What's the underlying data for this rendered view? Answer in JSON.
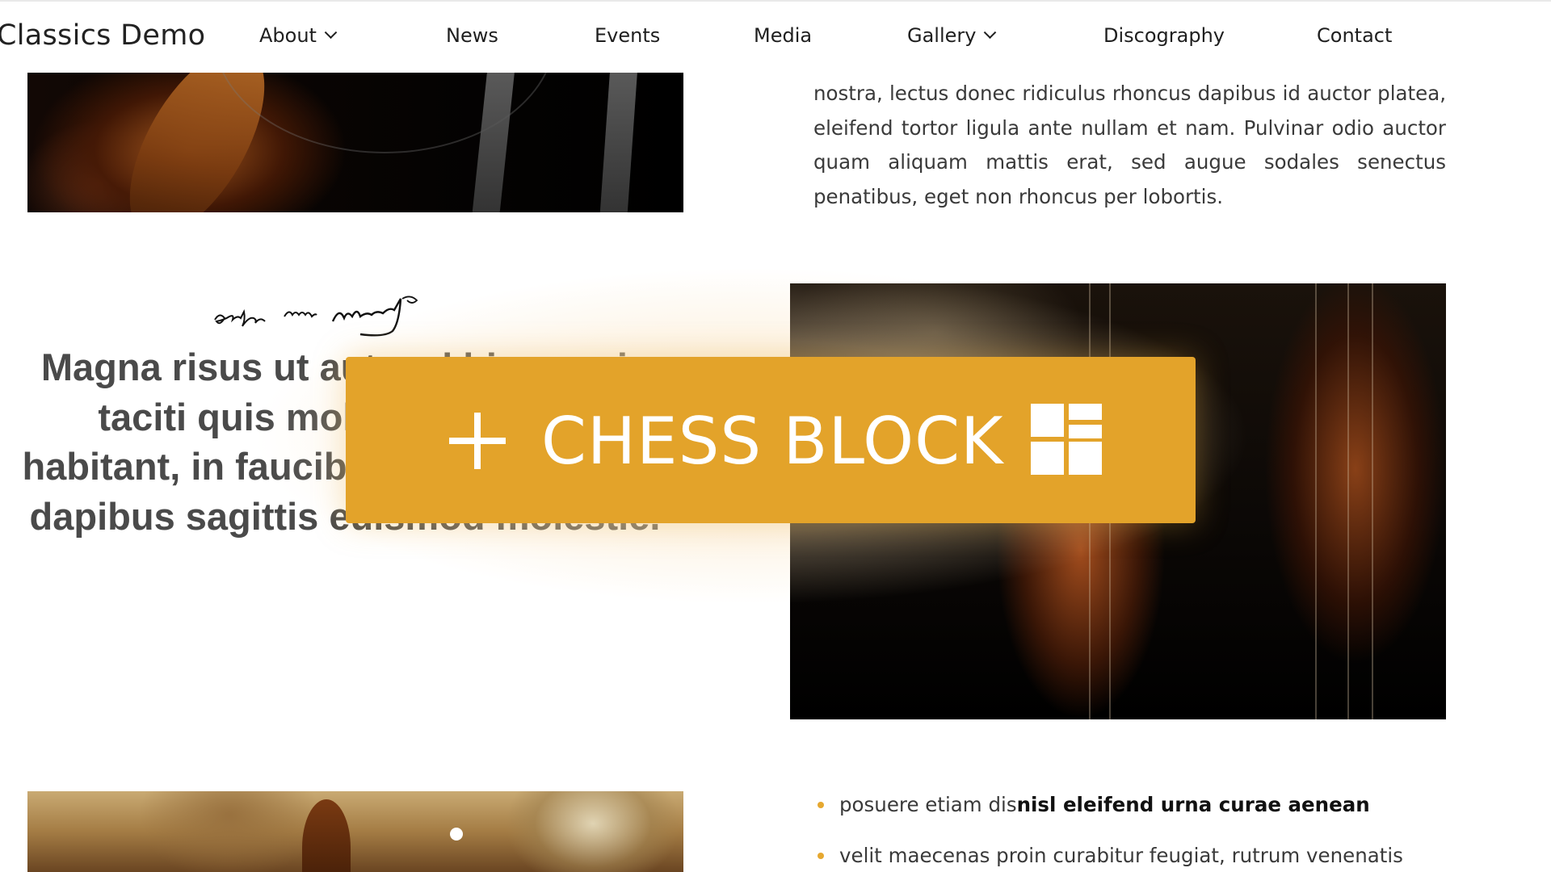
{
  "navbar": {
    "brand": "Classics Demo",
    "items": [
      {
        "label": "About",
        "has_dropdown": true
      },
      {
        "label": "News",
        "has_dropdown": false
      },
      {
        "label": "Events",
        "has_dropdown": false
      },
      {
        "label": "Media",
        "has_dropdown": false
      },
      {
        "label": "Gallery",
        "has_dropdown": true
      },
      {
        "label": "Discography",
        "has_dropdown": false
      },
      {
        "label": "Contact",
        "has_dropdown": false
      }
    ]
  },
  "content": {
    "intro_paragraph": "nostra, lectus donec ridiculus rhoncus dapibus id auctor platea, eleifend tortor ligula ante nullam et nam. Pulvinar odio auctor quam aliquam mattis erat, sed augue sodales senectus penatibus, eget non rhoncus per lobortis.",
    "signature": "Gottfgang Amadè Mozart",
    "quote": "Magna risus ut aut sed himenaeis taciti quis mollis accumsan habitant, in faucibus inceptos fusce dapibus sagittis euismod molestie.",
    "bullets": [
      {
        "text": "posuere etiam dis ",
        "bold": "nisl eleifend urna curae aenean"
      },
      {
        "text": "velit maecenas proin curabitur feugiat, rutrum venenatis",
        "bold": ""
      }
    ]
  },
  "overlay": {
    "label": "CHESS BLOCK",
    "plus_icon": "plus-icon",
    "grid_icon": "layout-grid-icon",
    "color": "#e3a32a"
  },
  "colors": {
    "accent": "#e3a32a",
    "bullet": "#e6a830",
    "text": "#3a3a3a",
    "quote": "#4a4a4a"
  }
}
